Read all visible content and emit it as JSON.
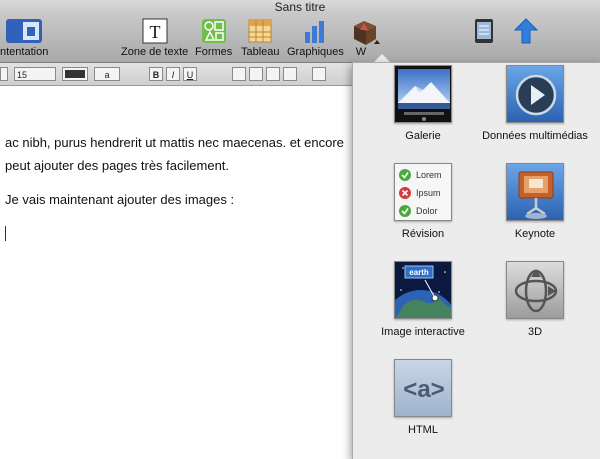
{
  "window": {
    "title": "Sans titre"
  },
  "toolbar": {
    "items": [
      {
        "label": "ntentation",
        "icon": "presentation-icon"
      },
      {
        "label": "Zone de texte",
        "icon": "text-box-icon"
      },
      {
        "label": "Formes",
        "icon": "shapes-icon"
      },
      {
        "label": "Tableau",
        "icon": "table-icon"
      },
      {
        "label": "Graphiques",
        "icon": "charts-icon"
      },
      {
        "label": "W",
        "icon": "media-box-icon"
      },
      {
        "label": "",
        "icon": "inspector-icon"
      },
      {
        "label": "",
        "icon": "share-icon"
      }
    ]
  },
  "formatbar": {
    "font_size": "15",
    "font_color": "#333333",
    "bold": "B",
    "italic": "I",
    "underline": "U",
    "highlight_glyph": "a"
  },
  "document": {
    "lines": [
      "ac nibh, purus hendrerit ut mattis nec maecenas. et encore",
      "peut ajouter des pages très facilement.",
      "Je vais maintenant ajouter des images :"
    ]
  },
  "widgets": [
    {
      "label": "Galerie",
      "icon": "gallery-icon"
    },
    {
      "label": "Données multimédias",
      "icon": "media-play-icon"
    },
    {
      "label": "Révision",
      "icon": "review-icon"
    },
    {
      "label": "Keynote",
      "icon": "keynote-icon"
    },
    {
      "label": "Image interactive",
      "icon": "earth-icon"
    },
    {
      "label": "3D",
      "icon": "3d-icon"
    },
    {
      "label": "HTML",
      "icon": "html-icon"
    }
  ],
  "review_items": [
    "Lorem",
    "Ipsum",
    "Dolor"
  ],
  "earth_badge": "earth",
  "html_glyph": "<a>"
}
